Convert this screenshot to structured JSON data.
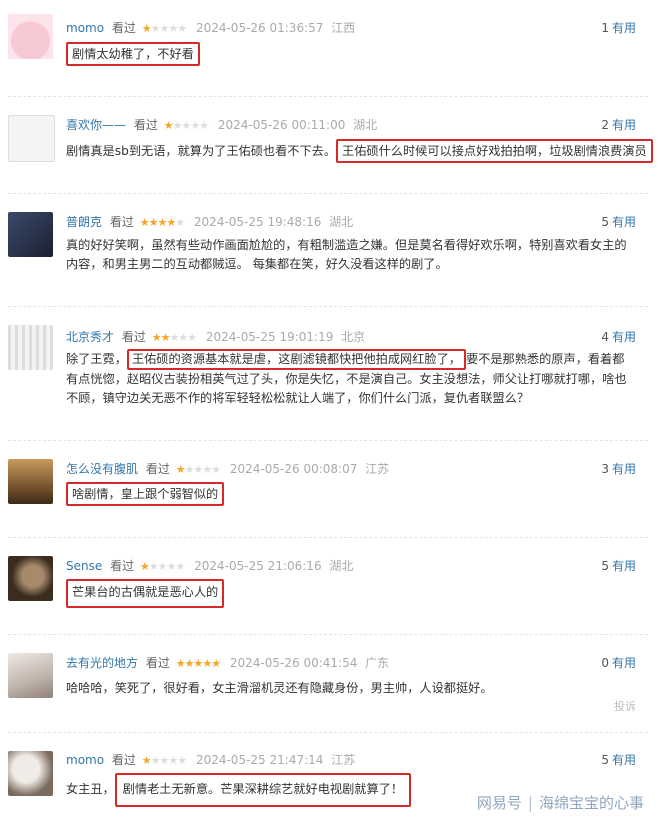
{
  "reviews": [
    {
      "user": "momo",
      "status": "看过",
      "stars": 1,
      "time": "2024-05-26 01:36:57",
      "location": "江西",
      "useful_count": "1",
      "useful_label": "有用",
      "content_pre": "",
      "content_hl": "剧情太幼稚了，不好看",
      "content_post": ""
    },
    {
      "user": "喜欢你——",
      "status": "看过",
      "stars": 1,
      "time": "2024-05-26 00:11:00",
      "location": "湖北",
      "useful_count": "2",
      "useful_label": "有用",
      "content_pre": "剧情真是sb到无语，就算为了王佑硕也看不下去。",
      "content_hl": "王佑硕什么时候可以接点好戏拍拍啊，垃圾剧情浪费演员",
      "content_post": ""
    },
    {
      "user": "普朗克",
      "status": "看过",
      "stars": 4,
      "time": "2024-05-25 19:48:16",
      "location": "湖北",
      "useful_count": "5",
      "useful_label": "有用",
      "content_pre": "真的好好笑啊，虽然有些动作画面尬尬的，有粗制滥造之嫌。但是莫名看得好欢乐啊，特别喜欢看女主的内容，和男主男二的互动都贼逗。 每集都在笑，好久没看这样的剧了。",
      "content_hl": "",
      "content_post": ""
    },
    {
      "user": "北京秀才",
      "status": "看过",
      "stars": 2,
      "time": "2024-05-25 19:01:19",
      "location": "北京",
      "useful_count": "4",
      "useful_label": "有用",
      "content_pre": "除了王霓，",
      "content_hl": "王佑硕的资源基本就是虐，这剧滤镜都快把他拍成网红脸了，",
      "content_post": "要不是那熟悉的原声，看着都有点恍惚，赵昭仪古装扮相英气过了头，你是失忆，不是演自己。女主没想法，师父让打哪就打哪，啥也不顾，镇守边关无恶不作的将军轻轻松松就让人端了，你们什么门派，复仇者联盟么？"
    },
    {
      "user": "怎么没有腹肌",
      "status": "看过",
      "stars": 1,
      "time": "2024-05-26 00:08:07",
      "location": "江苏",
      "useful_count": "3",
      "useful_label": "有用",
      "content_pre": "",
      "content_hl": "啥剧情，皇上跟个弱智似的",
      "content_post": ""
    },
    {
      "user": "Sense",
      "status": "看过",
      "stars": 1,
      "time": "2024-05-25 21:06:16",
      "location": "湖北",
      "useful_count": "5",
      "useful_label": "有用",
      "content_pre": "",
      "content_hl": "芒果台的古偶就是恶心人的",
      "content_post": ""
    },
    {
      "user": "去有光的地方",
      "status": "看过",
      "stars": 5,
      "time": "2024-05-26 00:41:54",
      "location": "广东",
      "useful_count": "0",
      "useful_label": "有用",
      "content_pre": "哈哈哈，笑死了，很好看，女主滑溜机灵还有隐藏身份，男主帅，人设都挺好。",
      "content_hl": "",
      "content_post": "",
      "report": "投诉"
    },
    {
      "user": "momo",
      "status": "看过",
      "stars": 1,
      "time": "2024-05-25 21:47:14",
      "location": "江苏",
      "useful_count": "5",
      "useful_label": "有用",
      "content_pre": "女主丑，",
      "content_hl": "剧情老土无新意。芒果深耕综艺就好电视剧就算了！",
      "content_post": ""
    }
  ],
  "watermark": {
    "brand": "网易号",
    "author": "海绵宝宝的心事"
  },
  "colors": {
    "highlight": "#d42a2a",
    "username": "#3377aa",
    "star": "#f5a623"
  }
}
